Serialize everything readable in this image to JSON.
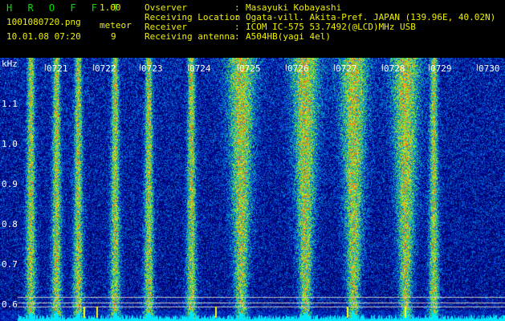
{
  "header": {
    "title": "H R O F F T",
    "version": "1.00",
    "file_name": "1001080720.png",
    "datetime": "10.01.08 07:20",
    "meteor_label": "meteor",
    "meteor_count": "9",
    "info": [
      {
        "label": "Ovserver",
        "value": "Masayuki Kobayashi"
      },
      {
        "label": "Receiving Location",
        "value": "Ogata-vill. Akita-Pref. JAPAN (139.96E, 40.02N)"
      },
      {
        "label": "Receiver",
        "value": "ICOM IC-575 53.7492(@LCD)MHz USB"
      },
      {
        "label": "Receiving antenna",
        "value": "A504HB(yagi 4el)"
      }
    ]
  },
  "spectrogram": {
    "y_unit": "kHz",
    "y_ticks": [
      "1.1",
      "1.0",
      "0.9",
      "0.8",
      "0.7",
      "0.6"
    ],
    "time_ticks": [
      "0721",
      "0722",
      "0723",
      "0724",
      "0725",
      "0726",
      "0727",
      "0728",
      "0729",
      "0730"
    ],
    "colors": {
      "header_green": "#00e000",
      "header_yellow": "#f0f000",
      "background": "#000000"
    }
  }
}
